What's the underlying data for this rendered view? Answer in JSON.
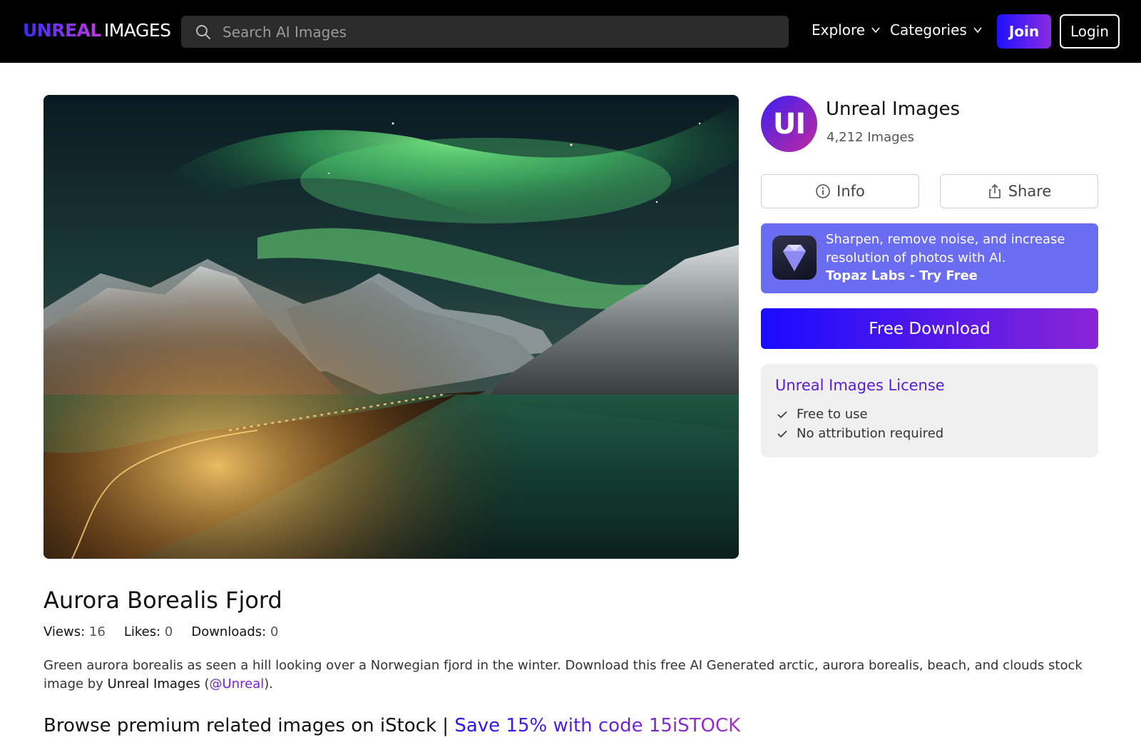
{
  "header": {
    "logo_part1": "UNREAL",
    "logo_part2": "IMAGES",
    "search_placeholder": "Search AI Images",
    "nav_explore": "Explore",
    "nav_categories": "Categories",
    "join_label": "Join",
    "login_label": "Login"
  },
  "author": {
    "initials": "UI",
    "name": "Unreal Images",
    "count": "4,212 Images"
  },
  "actions": {
    "info_label": "Info",
    "share_label": "Share"
  },
  "promo": {
    "text": "Sharpen, remove noise, and increase resolution of photos with AI.",
    "cta": "Topaz Labs - Try Free"
  },
  "download_label": "Free Download",
  "license": {
    "title": "Unreal Images License",
    "items": [
      "Free to use",
      "No attribution required"
    ]
  },
  "image": {
    "title": "Aurora Borealis Fjord",
    "stats": {
      "views_label": "Views:",
      "views": "16",
      "likes_label": "Likes:",
      "likes": "0",
      "downloads_label": "Downloads:",
      "downloads": "0"
    },
    "description": "Green aurora borealis as seen a hill looking over a Norwegian fjord in the winter. Download this free AI Generated arctic, aurora borealis, beach, and clouds stock image by",
    "author_name": "Unreal Images",
    "author_handle": "@Unreal",
    "paren_open": "(",
    "paren_close": ")."
  },
  "istock": {
    "lead": "Browse premium related images on iStock |",
    "offer": "Save 15% with code 15iSTOCK"
  },
  "colors": {
    "accent_purple": "#7a22d2",
    "download_gradient_start": "#1a0bff",
    "download_gradient_end": "#8a25d6",
    "promo_bg": "#6a6cf2"
  }
}
